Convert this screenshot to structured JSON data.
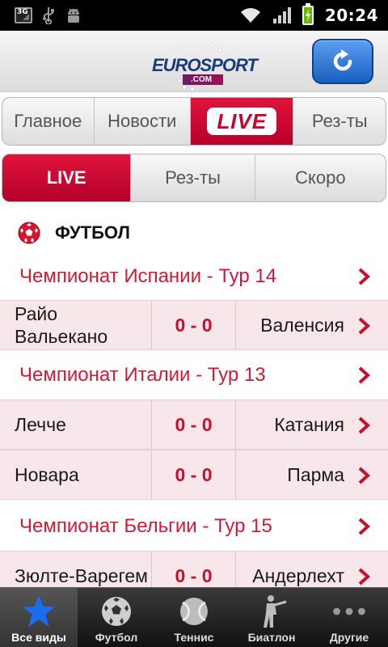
{
  "status_bar": {
    "network": "3G",
    "time": "20:24"
  },
  "header": {
    "logo_text": "EUROSPORT",
    "logo_sub": ".COM"
  },
  "main_tabs": [
    {
      "label": "Главное"
    },
    {
      "label": "Новости"
    },
    {
      "label": "LIVE"
    },
    {
      "label": "Рез-ты"
    }
  ],
  "sub_tabs": [
    {
      "label": "LIVE"
    },
    {
      "label": "Рез-ты"
    },
    {
      "label": "Скоро"
    }
  ],
  "sport": {
    "title": "ФУТБОЛ"
  },
  "leagues": [
    {
      "name": "Чемпионат Испании - Тур 14",
      "matches": [
        {
          "home": "Райо Вальекано",
          "score": "0 - 0",
          "away": "Валенсия"
        }
      ]
    },
    {
      "name": "Чемпионат Италии - Тур 13",
      "matches": [
        {
          "home": "Лечче",
          "score": "0 - 0",
          "away": "Катания"
        },
        {
          "home": "Новара",
          "score": "0 - 0",
          "away": "Парма"
        }
      ]
    },
    {
      "name": "Чемпионат Бельгии - Тур 15",
      "matches": [
        {
          "home": "Зюлте-Варегем",
          "score": "0 - 0",
          "away": "Андерлехт"
        }
      ]
    }
  ],
  "bottom_nav": [
    {
      "label": "Все виды",
      "icon": "star-icon"
    },
    {
      "label": "Футбол",
      "icon": "soccer-ball-icon"
    },
    {
      "label": "Теннис",
      "icon": "tennis-ball-icon"
    },
    {
      "label": "Биатлон",
      "icon": "biathlon-icon"
    },
    {
      "label": "Другие",
      "icon": "more-dots-icon"
    }
  ],
  "colors": {
    "accent_red": "#c8102e",
    "match_row_bg": "#f7e6ea",
    "refresh_blue": "#2a74d6"
  }
}
